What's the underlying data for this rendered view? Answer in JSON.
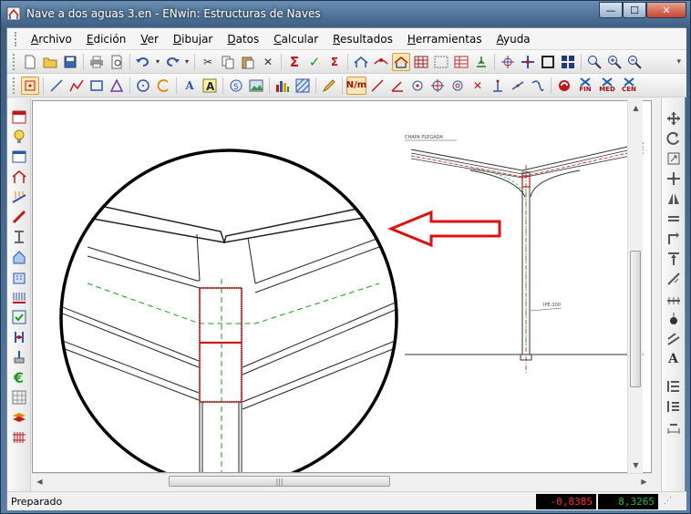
{
  "window": {
    "title": "Nave a dos aguas 3.en - ENwin: Estructuras de Naves",
    "minimize": "—",
    "maximize": "☐",
    "close": "✕"
  },
  "menu": {
    "items": [
      {
        "u": "A",
        "rest": "rchivo"
      },
      {
        "u": "E",
        "rest": "dición"
      },
      {
        "u": "V",
        "rest": "er"
      },
      {
        "u": "D",
        "rest": "ibujar"
      },
      {
        "u": "D",
        "rest": "atos"
      },
      {
        "u": "C",
        "rest": "alcular"
      },
      {
        "u": "R",
        "rest": "esultados"
      },
      {
        "u": "H",
        "rest": "erramientas"
      },
      {
        "u": "A",
        "rest": "yuda"
      }
    ]
  },
  "toolbar2": {
    "nm_label": "N/m",
    "fin_label": "FIN",
    "med_label": "MED",
    "cen_label": "CEN"
  },
  "drawing": {
    "label_chapa": "CHAPA PLEGADA",
    "label_profile": "IPE-200"
  },
  "status": {
    "text": "Preparado",
    "coord_x": "-0,8385",
    "coord_y": "8,3265"
  }
}
